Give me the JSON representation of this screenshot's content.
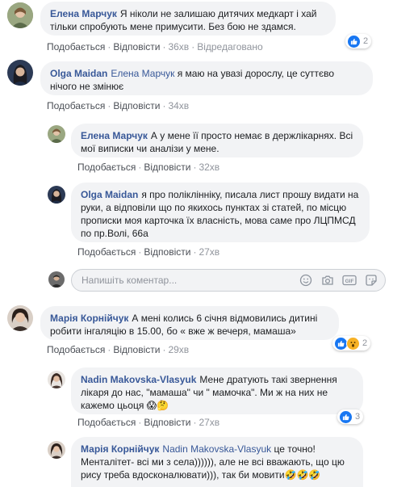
{
  "comments": [
    {
      "author": "Елена Марчук",
      "text": "Я ніколи не залишаю дитячих медкарт і хай тільки спробують мене примусити. Без бою не здамся.",
      "like": "Подобається",
      "reply": "Відповісти",
      "time": "36хв",
      "edited": "Відредаговано",
      "reactions": "2"
    },
    {
      "author": "Olga Maidan",
      "tag": "Елена Марчук",
      "text": "я маю на увазі дорослу, це суттєво нічого не змінює",
      "like": "Подобається",
      "reply": "Відповісти",
      "time": "34хв"
    },
    {
      "author": "Елена Марчук",
      "text": "А у мене її просто немає в держлікарнях. Всі мої виписки чи аналізи у мене.",
      "like": "Подобається",
      "reply": "Відповісти",
      "time": "32хв"
    },
    {
      "author": "Olga Maidan",
      "text": "я про поліклінніку, писала лист прошу видати на руки, а відповіли що по якихось пунктах зі статей, по місцю прописки моя карточка їх власність, мова саме про ЛЦПМСД по пр.Волі, 66а",
      "like": "Подобається",
      "reply": "Відповісти",
      "time": "27хв"
    },
    {
      "author": "Марія Корнійчук",
      "text": "А мені колись 6 січня відмовились дитині робити інгаляцію в 15.00, бо « вже ж вечеря, мамаша»",
      "like": "Подобається",
      "reply": "Відповісти",
      "time": "29хв",
      "reactions": "2"
    },
    {
      "author": "Nadin Makovska-Vlasyuk",
      "text": "Мене дратують такі звернення лікаря до нас, \"мамаша\" чи \" мамочка\". Ми ж на них не кажемо цьоця",
      "emoji": "😱🤔",
      "like": "Подобається",
      "reply": "Відповісти",
      "time": "27хв",
      "reactions": "3"
    },
    {
      "author": "Марія Корнійчук",
      "tag": "Nadin Makovska-Vlasyuk",
      "text": "це точно! Менталітет- всі ми з села)))))), але не всі вважають, що цю рису треба вдосконалювати))), так би мовити",
      "emoji": "🤣🤣🤣"
    }
  ],
  "composer": {
    "placeholder": "Напишіть коментар..."
  },
  "colors": {
    "link": "#385898",
    "bubble": "#f2f3f5",
    "meta": "#90949c",
    "like_blue": "#1877f2"
  }
}
